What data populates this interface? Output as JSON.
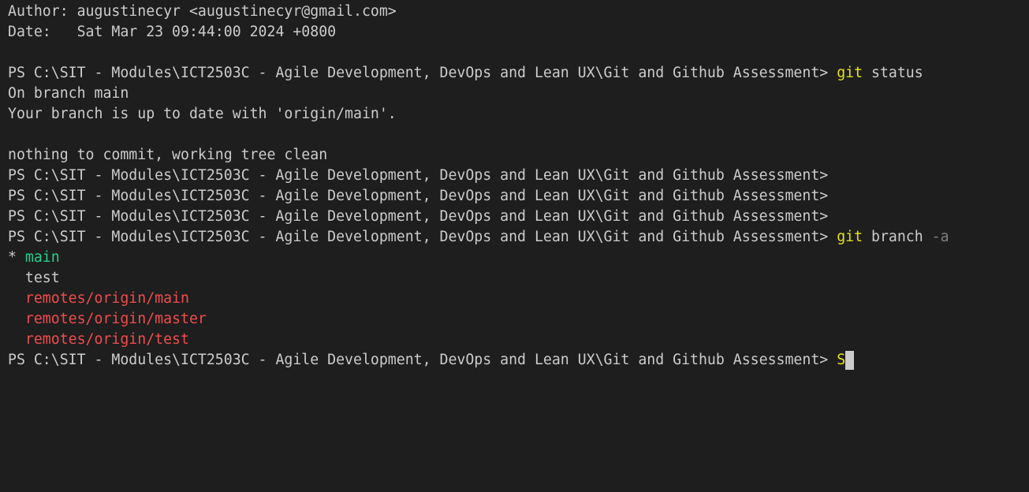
{
  "colors": {
    "background": "#1e1e1e",
    "foreground": "#cccccc",
    "command": "#e5e510",
    "argument_dim": "#808080",
    "current_branch": "#23d18b",
    "remote_branch": "#f14c4c"
  },
  "prompt": "PS C:\\SIT - Modules\\ICT2503C - Agile Development, DevOps and Lean UX\\Git and Github Assessment>",
  "log": {
    "author_line": "Author: augustinecyr <augustinecyr@gmail.com>",
    "date_line": "Date:   Sat Mar 23 09:44:00 2024 +0800"
  },
  "status_cmd": {
    "cmd": "git",
    "args": "status"
  },
  "status_output": {
    "branch_line": "On branch main",
    "uptodate_line": "Your branch is up to date with 'origin/main'.",
    "clean_line": "nothing to commit, working tree clean"
  },
  "branch_cmd": {
    "cmd": "git",
    "args": "branch",
    "flag": "-a"
  },
  "branches": {
    "current_marker": "* ",
    "current": "main",
    "local_other": "  test",
    "remote_indent": "  ",
    "remotes": [
      "remotes/origin/main",
      "remotes/origin/master",
      "remotes/origin/test"
    ]
  },
  "current_input": "S"
}
